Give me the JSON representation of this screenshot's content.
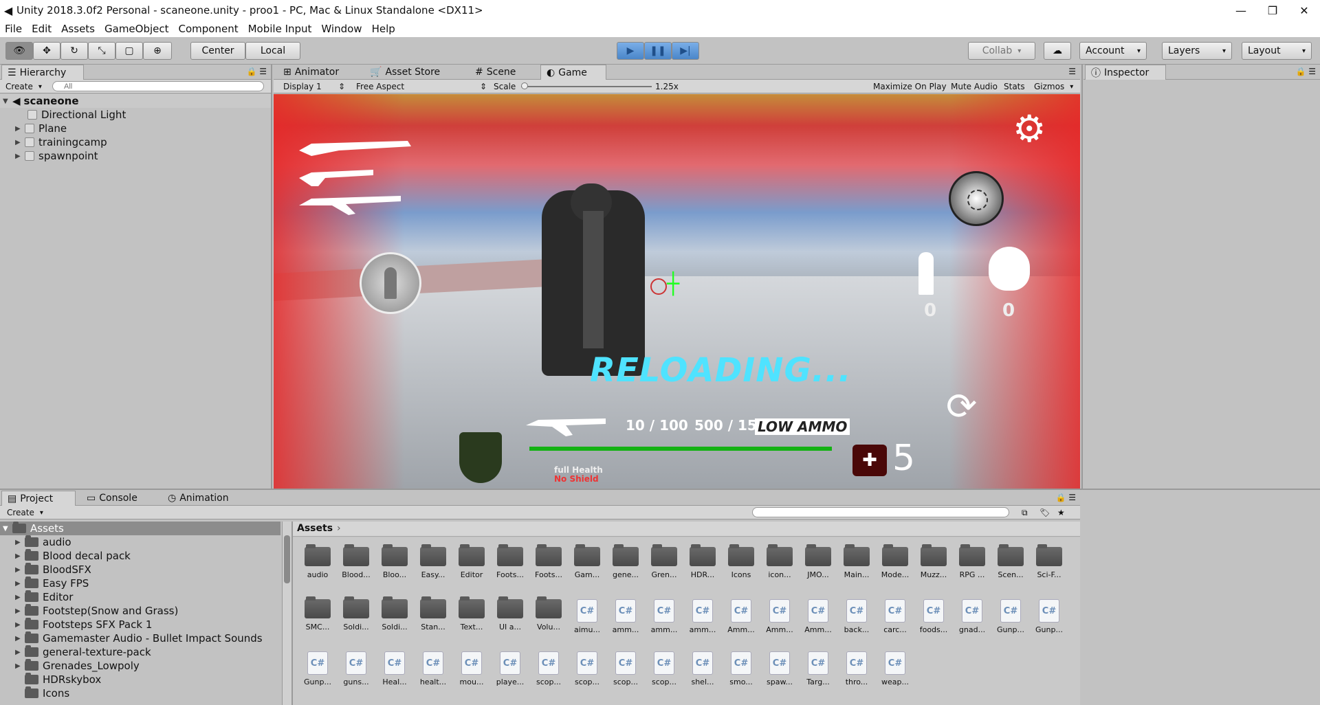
{
  "window": {
    "title": "Unity 2018.3.0f2 Personal - scaneone.unity - proo1 - PC, Mac & Linux Standalone <DX11>",
    "min": "—",
    "max": "❐",
    "close": "✕",
    "logo": "unity-logo-icon"
  },
  "menu": [
    "File",
    "Edit",
    "Assets",
    "GameObject",
    "Component",
    "Mobile Input",
    "Window",
    "Help"
  ],
  "toolbar": {
    "center": "Center",
    "local": "Local",
    "collab": "Collab",
    "account": "Account",
    "layers": "Layers",
    "layout": "Layout"
  },
  "hierarchy": {
    "tab": "Hierarchy",
    "create": "Create",
    "search_placeholder": "All",
    "scene": "scaneone",
    "items": [
      "Directional Light",
      "Plane",
      "trainingcamp",
      "spawnpoint"
    ]
  },
  "center_tabs": [
    "Animator",
    "Asset Store",
    "Scene",
    "Game"
  ],
  "game_bar": {
    "display": "Display 1",
    "aspect": "Free Aspect",
    "scale_label": "Scale",
    "scale_value": "1.25x",
    "maximize": "Maximize On Play",
    "mute": "Mute Audio",
    "stats": "Stats",
    "gizmos": "Gizmos"
  },
  "game_hud": {
    "reloading": "RELOADING...",
    "ammo": "10 / 100",
    "reserve": "500 / 150",
    "low_ammo": "LOW AMMO",
    "medkits": "5",
    "health_label": "full Health",
    "shield_label": "No Shield",
    "grenade_count": "0",
    "ammo_count": "0",
    "health_fraction": 1.0
  },
  "inspector": {
    "tab": "Inspector"
  },
  "bottom_tabs": [
    "Project",
    "Console",
    "Animation"
  ],
  "project": {
    "create": "Create",
    "root": "Assets",
    "folders": [
      "audio",
      "Blood decal pack",
      "BloodSFX",
      "Easy FPS",
      "Editor",
      "Footstep(Snow and Grass)",
      "Footsteps SFX Pack 1",
      "Gamemaster Audio - Bullet Impact Sounds",
      "general-texture-pack",
      "Grenades_Lowpoly",
      "HDRskybox",
      "Icons"
    ]
  },
  "assets_view": {
    "breadcrumb": "Assets",
    "row1": [
      "audio",
      "Blood...",
      "Bloo...",
      "Easy...",
      "Editor",
      "Foots...",
      "Foots...",
      "Gam...",
      "gene...",
      "Gren...",
      "HDR...",
      "Icons",
      "icon...",
      "JMO...",
      "Main...",
      "Mode...",
      "Muzz...",
      "RPG ...",
      "Scen...",
      "Sci-F..."
    ],
    "row2_folders": [
      "SMC...",
      "Soldi...",
      "Soldi...",
      "Stan...",
      "Text...",
      "UI a...",
      "Volu..."
    ],
    "row2_scripts": [
      "aimu...",
      "amm...",
      "amm...",
      "amm...",
      "Amm...",
      "Amm...",
      "Amm...",
      "back...",
      "carc...",
      "foods...",
      "gnad...",
      "Gunp...",
      "Gunp..."
    ],
    "row3_scripts": [
      "Gunp...",
      "guns...",
      "Heal...",
      "healt...",
      "mou...",
      "playe...",
      "scop...",
      "scop...",
      "scop...",
      "scop...",
      "shel...",
      "smo...",
      "spaw...",
      "Targ...",
      "thro...",
      "weap..."
    ],
    "cs_label": "C#"
  }
}
